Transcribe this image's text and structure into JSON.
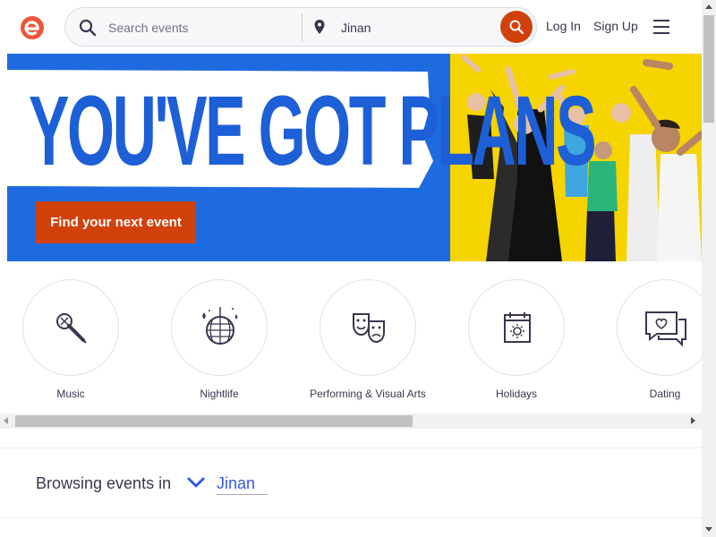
{
  "header": {
    "search_placeholder": "Search events",
    "location_value": "Jinan",
    "login_label": "Log In",
    "signup_label": "Sign Up",
    "brand_color": "#d1410c"
  },
  "hero": {
    "headline": "YOU'VE GOT PLANS",
    "cta_label": "Find your next event",
    "colors": {
      "blue": "#1e6be1",
      "yellow": "#f5d400",
      "cta": "#d1410c"
    }
  },
  "categories": [
    {
      "label": "Music",
      "icon": "microphone-icon"
    },
    {
      "label": "Nightlife",
      "icon": "disco-ball-icon"
    },
    {
      "label": "Performing & Visual Arts",
      "icon": "theater-masks-icon"
    },
    {
      "label": "Holidays",
      "icon": "calendar-sun-icon"
    },
    {
      "label": "Dating",
      "icon": "heart-chat-icon"
    }
  ],
  "browsing": {
    "prefix": "Browsing events in",
    "location": "Jinan"
  }
}
